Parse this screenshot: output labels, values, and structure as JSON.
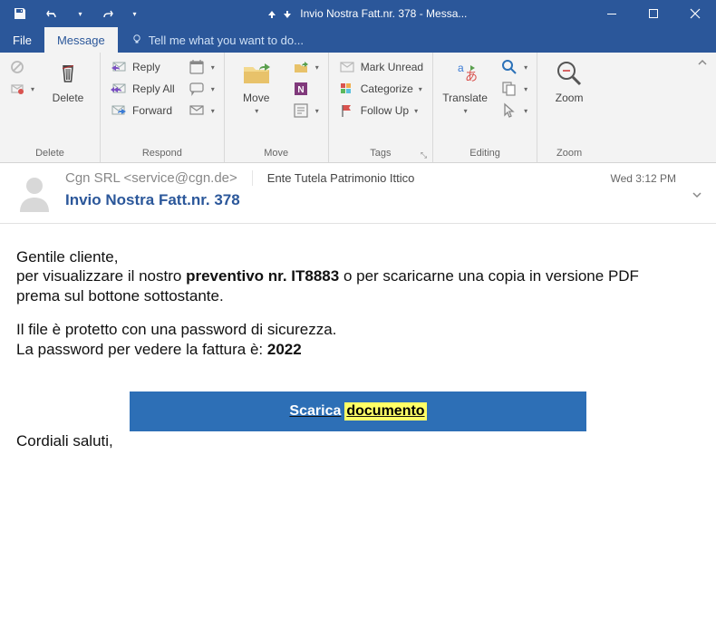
{
  "window": {
    "title": "Invio Nostra Fatt.nr. 378 - Messa..."
  },
  "tabs": {
    "file": "File",
    "message": "Message",
    "tell": "Tell me what you want to do..."
  },
  "ribbon": {
    "delete": {
      "label": "Delete",
      "big": "Delete"
    },
    "respond": {
      "label": "Respond",
      "reply": "Reply",
      "replyall": "Reply All",
      "forward": "Forward"
    },
    "move": {
      "label": "Move",
      "big": "Move"
    },
    "tags": {
      "label": "Tags",
      "unread": "Mark Unread",
      "categorize": "Categorize",
      "followup": "Follow Up"
    },
    "editing": {
      "label": "Editing",
      "big": "Translate"
    },
    "zoom": {
      "label": "Zoom",
      "big": "Zoom"
    }
  },
  "header": {
    "from": "Cgn SRL <service@cgn.de>",
    "recipient": "Ente Tutela Patrimonio Ittico",
    "date": "Wed 3:12 PM",
    "subject": "Invio Nostra Fatt.nr. 378"
  },
  "body": {
    "l1": "Gentile cliente,",
    "l2a": "per visualizzare il nostro ",
    "l2b": "preventivo nr. IT8883",
    "l2c": " o per scaricarne una copia in versione PDF",
    "l3": "prema sul bottone sottostante.",
    "l4": "Il file è protetto con una password di sicurezza.",
    "l5a": "La password per vedere la fattura è: ",
    "l5b": "2022",
    "btn1": "Scarica",
    "btn2": "documento",
    "closing": "Cordiali saluti,"
  }
}
